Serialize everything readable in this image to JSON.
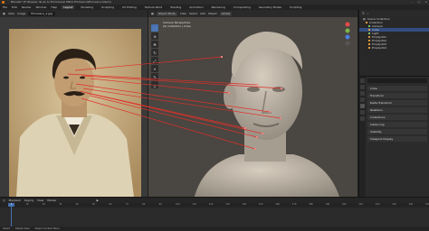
{
  "window": {
    "title": "Blender* [F:\\Drawer de en to Emmanuel Mihai Eminescu\\Eminescu.blend]"
  },
  "menubar": {
    "menus": [
      "File",
      "Edit",
      "Render",
      "Window",
      "Help"
    ],
    "workspaces": [
      "Layout",
      "Modeling",
      "Sculpting",
      "UV Editing",
      "Texture Paint",
      "Shading",
      "Animation",
      "Rendering",
      "Compositing",
      "Geometry Nodes",
      "Scripting"
    ],
    "active_workspace": "Layout"
  },
  "image_editor": {
    "view_label": "View",
    "image_label": "Image",
    "image_name": "Eminescu_1.jpg"
  },
  "viewport": {
    "mode": "Object Mode",
    "menus": [
      "View",
      "Select",
      "Add",
      "Object"
    ],
    "shading": "Global",
    "overlay_line1": "Camera Perspective",
    "overlay_line2": "(0) Collection | Cube"
  },
  "outliner": {
    "header": "Scene Collection",
    "items": [
      {
        "label": "Collection",
        "type": "collection"
      },
      {
        "label": "Camera",
        "type": "camera"
      },
      {
        "label": "Cube",
        "type": "mesh"
      },
      {
        "label": "Light",
        "type": "light"
      },
      {
        "label": "Empty.001",
        "type": "empty"
      },
      {
        "label": "Empty.002",
        "type": "empty"
      },
      {
        "label": "Empty.003",
        "type": "empty"
      },
      {
        "label": "Empty.004",
        "type": "empty"
      }
    ]
  },
  "properties": {
    "object_name": "Cube",
    "panels": [
      "Transform",
      "Delta Transform",
      "Relations",
      "Collections",
      "Instancing",
      "Visibility",
      "Viewport Display"
    ]
  },
  "timeline": {
    "menus": [
      "Playback",
      "Keying",
      "View",
      "Marker"
    ],
    "current_frame": "1",
    "ticks": [
      "0",
      "10",
      "20",
      "30",
      "40",
      "50",
      "60",
      "70",
      "80",
      "90",
      "100",
      "110",
      "120",
      "130",
      "140",
      "150",
      "160",
      "170",
      "180",
      "190",
      "200",
      "210",
      "220",
      "230",
      "240",
      "250"
    ]
  },
  "statusbar": {
    "items": [
      "Select",
      "Rotate View",
      "Object Context Menu"
    ]
  },
  "colors": {
    "accent": "#4772b3",
    "blender_orange": "#e87d0d",
    "link_line": "#e0302a"
  }
}
